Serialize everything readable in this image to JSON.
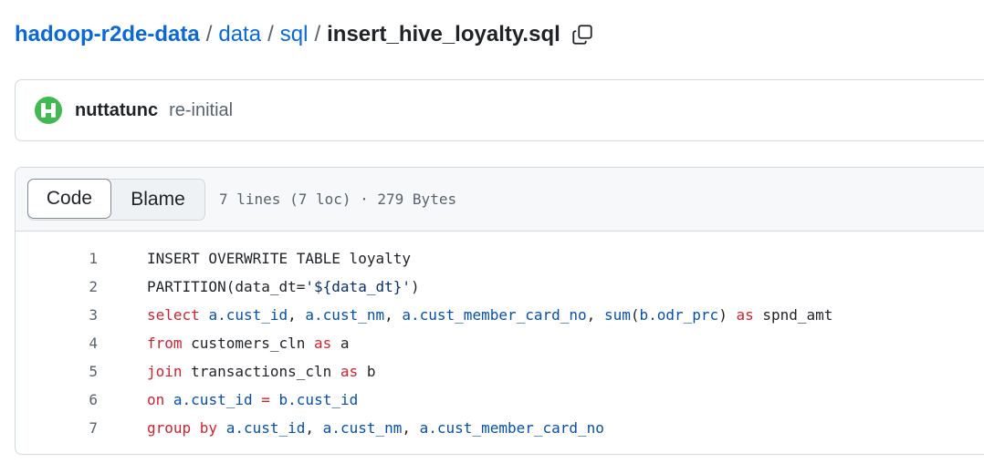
{
  "breadcrumb": {
    "repo": "hadoop-r2de-data",
    "folders": [
      "data",
      "sql"
    ],
    "file": "insert_hive_loyalty.sql",
    "separator": "/"
  },
  "commit": {
    "author": "nuttatunc",
    "message": "re-initial"
  },
  "file_header": {
    "tabs": [
      "Code",
      "Blame"
    ],
    "active_tab": "Code",
    "meta": "7 lines (7 loc) · 279 Bytes"
  },
  "code_lines": [
    {
      "num": "1",
      "tokens": [
        {
          "t": "INSERT OVERWRITE TABLE loyalty",
          "c": "pl"
        }
      ]
    },
    {
      "num": "2",
      "tokens": [
        {
          "t": "PARTITION(data_dt=",
          "c": "pl"
        },
        {
          "t": "'${data_dt}'",
          "c": "str"
        },
        {
          "t": ")",
          "c": "pl"
        }
      ]
    },
    {
      "num": "3",
      "tokens": [
        {
          "t": "select",
          "c": "kw"
        },
        {
          "t": " ",
          "c": "pl"
        },
        {
          "t": "a.cust_id",
          "c": "id"
        },
        {
          "t": ", ",
          "c": "pl"
        },
        {
          "t": "a.cust_nm",
          "c": "id"
        },
        {
          "t": ", ",
          "c": "pl"
        },
        {
          "t": "a.cust_member_card_no",
          "c": "id"
        },
        {
          "t": ", ",
          "c": "pl"
        },
        {
          "t": "sum",
          "c": "id"
        },
        {
          "t": "(",
          "c": "pl"
        },
        {
          "t": "b.odr_prc",
          "c": "id"
        },
        {
          "t": ") ",
          "c": "pl"
        },
        {
          "t": "as",
          "c": "kw"
        },
        {
          "t": " spnd_amt",
          "c": "pl"
        }
      ]
    },
    {
      "num": "4",
      "tokens": [
        {
          "t": "from",
          "c": "kw"
        },
        {
          "t": " customers_cln ",
          "c": "pl"
        },
        {
          "t": "as",
          "c": "kw"
        },
        {
          "t": " a",
          "c": "pl"
        }
      ]
    },
    {
      "num": "5",
      "tokens": [
        {
          "t": "join",
          "c": "kw"
        },
        {
          "t": " transactions_cln ",
          "c": "pl"
        },
        {
          "t": "as",
          "c": "kw"
        },
        {
          "t": " b",
          "c": "pl"
        }
      ]
    },
    {
      "num": "6",
      "tokens": [
        {
          "t": "on",
          "c": "kw"
        },
        {
          "t": " ",
          "c": "pl"
        },
        {
          "t": "a.cust_id",
          "c": "id"
        },
        {
          "t": " ",
          "c": "pl"
        },
        {
          "t": "=",
          "c": "kw"
        },
        {
          "t": " ",
          "c": "pl"
        },
        {
          "t": "b.cust_id",
          "c": "id"
        }
      ]
    },
    {
      "num": "7",
      "tokens": [
        {
          "t": "group by",
          "c": "kw"
        },
        {
          "t": " ",
          "c": "pl"
        },
        {
          "t": "a.cust_id",
          "c": "id"
        },
        {
          "t": ", ",
          "c": "pl"
        },
        {
          "t": "a.cust_nm",
          "c": "id"
        },
        {
          "t": ", ",
          "c": "pl"
        },
        {
          "t": "a.cust_member_card_no",
          "c": "id"
        }
      ]
    }
  ],
  "colors": {
    "link": "#0969da",
    "keyword": "#cf222e",
    "identifier": "#0550ae",
    "string": "#0a3069",
    "avatar_green": "#3fb950"
  },
  "icons": {
    "copy": "copy-icon",
    "avatar": "user-avatar"
  }
}
